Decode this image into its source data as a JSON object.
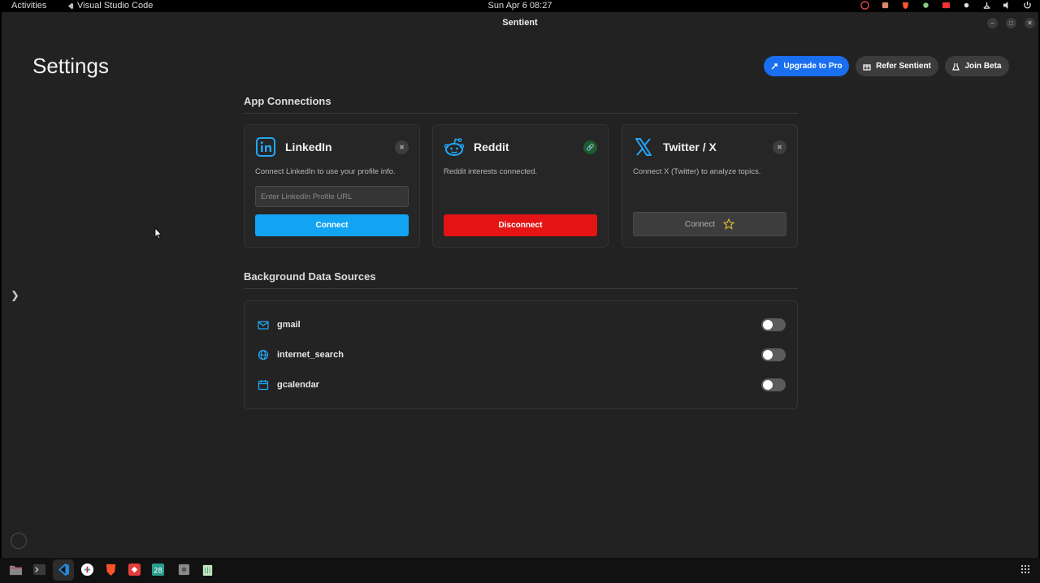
{
  "topbar": {
    "activities": "Activities",
    "app_name": "Visual Studio Code",
    "clock": "Sun Apr 6  08:27"
  },
  "window": {
    "title": "Sentient"
  },
  "page": {
    "title": "Settings"
  },
  "header_buttons": {
    "upgrade": "Upgrade to Pro",
    "refer": "Refer Sentient",
    "beta": "Join Beta"
  },
  "app_connections": {
    "title": "App Connections",
    "cards": [
      {
        "name": "LinkedIn",
        "desc": "Connect LinkedIn to use your profile info.",
        "placeholder": "Enter LinkedIn Profile URL",
        "button": "Connect",
        "connected": false
      },
      {
        "name": "Reddit",
        "desc": "Reddit interests connected.",
        "button": "Disconnect",
        "connected": true
      },
      {
        "name": "Twitter / X",
        "desc": "Connect X (Twitter) to analyze topics.",
        "button": "Connect",
        "connected": false
      }
    ]
  },
  "background_sources": {
    "title": "Background Data Sources",
    "items": [
      {
        "label": "gmail",
        "icon": "mail-icon",
        "enabled": false
      },
      {
        "label": "internet_search",
        "icon": "globe-icon",
        "enabled": false
      },
      {
        "label": "gcalendar",
        "icon": "calendar-icon",
        "enabled": false
      }
    ]
  },
  "dock": {
    "calendar_day": "28"
  },
  "colors": {
    "accent_blue": "#1a6ef0",
    "connect_blue": "#12a4f2",
    "disconnect_red": "#e41414",
    "icon_blue": "#22a6f5",
    "success_green": "#4fd07a"
  }
}
